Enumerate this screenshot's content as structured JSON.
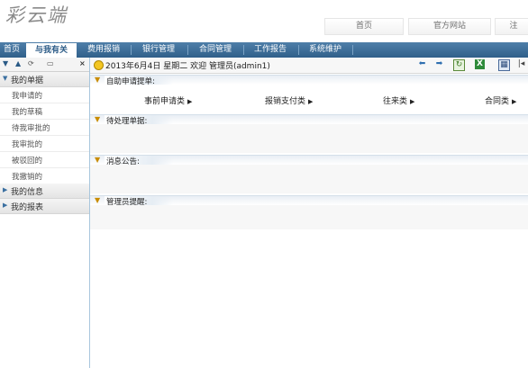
{
  "app": {
    "logo": "彩云端"
  },
  "top_links": [
    "首页",
    "官方网站",
    "注"
  ],
  "nav": {
    "tabs": [
      "首页",
      "与我有关",
      "费用报销",
      "银行管理",
      "合同管理",
      "工作报告",
      "系统维护"
    ],
    "active_index": 1
  },
  "left": {
    "sections": [
      {
        "label": "我的单据",
        "expanded": true,
        "items": [
          "我申请的",
          "我的草稿",
          "待我审批的",
          "我审批的",
          "被驳回的",
          "我撤销的"
        ]
      },
      {
        "label": "我的信息",
        "expanded": false
      },
      {
        "label": "我的报表",
        "expanded": false
      }
    ]
  },
  "status": {
    "date_text": "2013年6月4日 星期二 欢迎 管理员(admin1)"
  },
  "panels": [
    {
      "title": "自助申请提单:",
      "categories": [
        "事前申请类",
        "报销支付类",
        "往来类",
        "合同类"
      ]
    },
    {
      "title": "待处理单据:"
    },
    {
      "title": "消息公告:"
    },
    {
      "title": "管理员提醒:"
    }
  ],
  "colors": {
    "nav_bar": "#3b6b96",
    "accent": "#2a5a86",
    "panel_tri": "#c98c00"
  },
  "icons": [
    "expand-all-icon",
    "collapse-all-icon",
    "refresh-icon",
    "tool-icon",
    "close-icon",
    "back-arrow-icon",
    "forward-arrow-icon",
    "refresh-page-icon",
    "excel-icon",
    "calculator-icon"
  ]
}
